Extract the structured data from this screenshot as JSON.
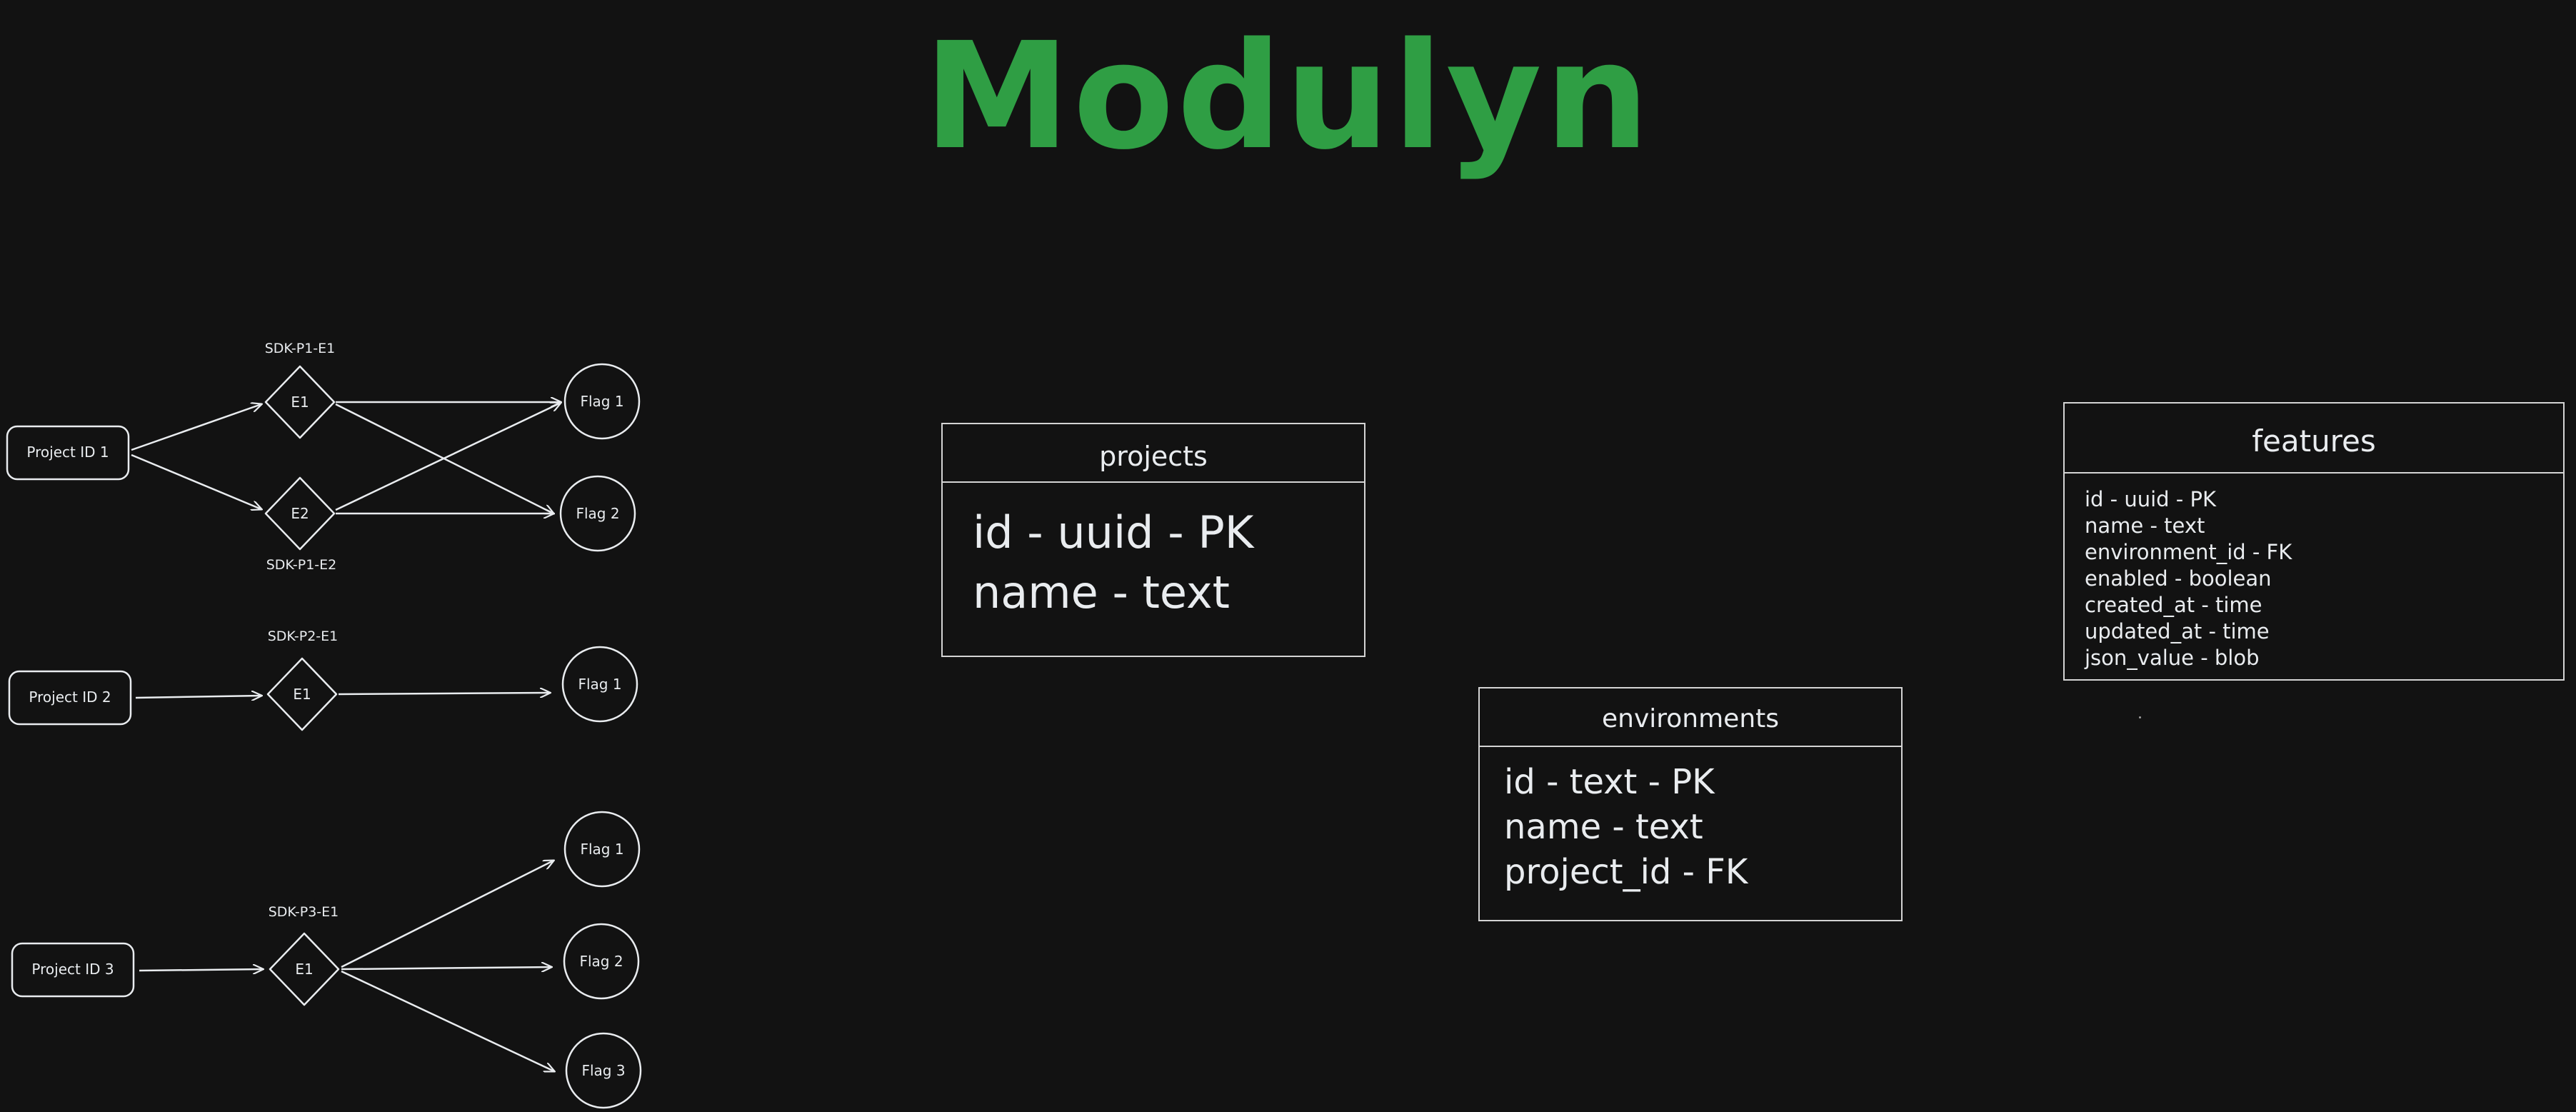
{
  "title": "Modulyn",
  "colors": {
    "background": "#121212",
    "title": "#2f9e44",
    "stroke": "#e9ecef"
  },
  "flow": {
    "projects": [
      {
        "label": "Project ID 1",
        "environments": [
          {
            "label": "E1",
            "sdk": "SDK-P1-E1"
          },
          {
            "label": "E2",
            "sdk": "SDK-P1-E2"
          }
        ],
        "flags": [
          "Flag 1",
          "Flag 2"
        ]
      },
      {
        "label": "Project ID 2",
        "environments": [
          {
            "label": "E1",
            "sdk": "SDK-P2-E1"
          }
        ],
        "flags": [
          "Flag 1"
        ]
      },
      {
        "label": "Project ID 3",
        "environments": [
          {
            "label": "E1",
            "sdk": "SDK-P3-E1"
          }
        ],
        "flags": [
          "Flag 1",
          "Flag 2",
          "Flag 3"
        ]
      }
    ]
  },
  "tables": {
    "projects": {
      "name": "projects",
      "fields": [
        "id - uuid - PK",
        "name - text"
      ]
    },
    "environments": {
      "name": "environments",
      "fields": [
        "id - text - PK",
        "name - text",
        "project_id - FK"
      ]
    },
    "features": {
      "name": "features",
      "fields": [
        "id - uuid - PK",
        "name - text",
        "environment_id - FK",
        "enabled - boolean",
        "created_at - time",
        "updated_at - time",
        "json_value - blob"
      ]
    }
  }
}
